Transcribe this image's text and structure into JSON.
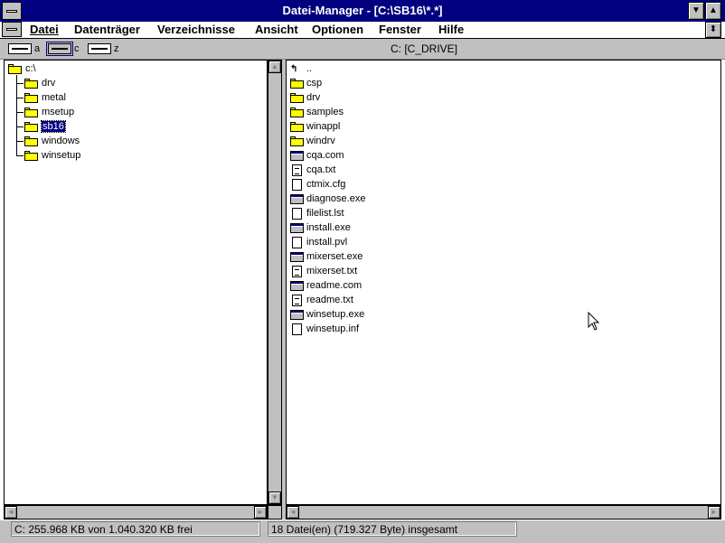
{
  "window": {
    "title": "Datei-Manager - [C:\\SB16\\*.*]"
  },
  "menu": {
    "items": [
      {
        "label": "Datei"
      },
      {
        "label": "Datenträger"
      },
      {
        "label": "Verzeichnisse"
      },
      {
        "label": "Ansicht"
      },
      {
        "label": "Optionen"
      },
      {
        "label": "Fenster"
      },
      {
        "label": "Hilfe"
      }
    ]
  },
  "drives": [
    {
      "letter": "a"
    },
    {
      "letter": "c",
      "selected": true
    },
    {
      "letter": "z"
    }
  ],
  "volume_label": "C: [C_DRIVE]",
  "tree": {
    "root": "c:\\",
    "children": [
      {
        "label": "drv"
      },
      {
        "label": "metal"
      },
      {
        "label": "msetup"
      },
      {
        "label": "sb16",
        "selected": true
      },
      {
        "label": "windows"
      },
      {
        "label": "winsetup"
      }
    ]
  },
  "files": {
    "up_label": "..",
    "items": [
      {
        "name": "csp",
        "icon": "folder-icon"
      },
      {
        "name": "drv",
        "icon": "folder-icon"
      },
      {
        "name": "samples",
        "icon": "folder-icon"
      },
      {
        "name": "winappl",
        "icon": "folder-icon"
      },
      {
        "name": "windrv",
        "icon": "folder-icon"
      },
      {
        "name": "cqa.com",
        "icon": "program-file-icon"
      },
      {
        "name": "cqa.txt",
        "icon": "text-file-icon"
      },
      {
        "name": "ctmix.cfg",
        "icon": "document-file-icon"
      },
      {
        "name": "diagnose.exe",
        "icon": "program-file-icon"
      },
      {
        "name": "filelist.lst",
        "icon": "document-file-icon"
      },
      {
        "name": "install.exe",
        "icon": "program-file-icon"
      },
      {
        "name": "install.pvl",
        "icon": "document-file-icon"
      },
      {
        "name": "mixerset.exe",
        "icon": "program-file-icon"
      },
      {
        "name": "mixerset.txt",
        "icon": "text-file-icon"
      },
      {
        "name": "readme.com",
        "icon": "program-file-icon"
      },
      {
        "name": "readme.txt",
        "icon": "text-file-icon"
      },
      {
        "name": "winsetup.exe",
        "icon": "program-file-icon"
      },
      {
        "name": "winsetup.inf",
        "icon": "document-file-icon"
      }
    ]
  },
  "status": {
    "free_space": "C: 255.968 KB von 1.040.320 KB frei",
    "file_count": "18 Datei(en) (719.327 Byte) insgesamt"
  }
}
